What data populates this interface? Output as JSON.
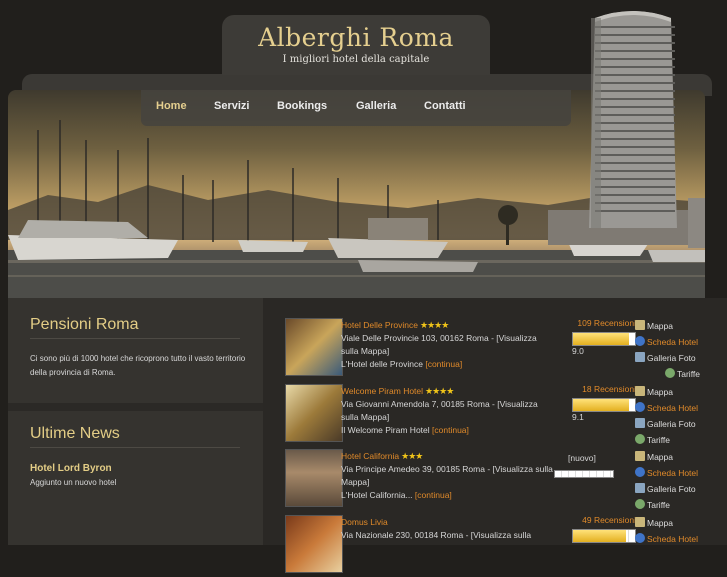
{
  "header": {
    "title": "Alberghi Roma",
    "subtitle": "I migliori hotel della capitale"
  },
  "nav": [
    {
      "label": "Home",
      "active": true
    },
    {
      "label": "Servizi"
    },
    {
      "label": "Bookings"
    },
    {
      "label": "Galleria"
    },
    {
      "label": "Contatti"
    }
  ],
  "sidebar": {
    "pensioni_title": "Pensioni Roma",
    "pensioni_text": "Ci sono più di 1000 hotel che ricoprono tutto il vasto territorio della provincia di Roma.",
    "news_title": "Ultime News",
    "news_item_title": "Hotel Lord Byron",
    "news_item_text": "Aggiunto un nuovo hotel"
  },
  "hotels": [
    {
      "name": "Hotel Delle Province",
      "stars": "★★★★",
      "address": "Viale Delle Provincie 103, 00162 Roma - [Visualizza sulla Mappa]",
      "desc": "L'Hotel delle Province",
      "more": "[continua]",
      "reviews": "109 Recensioni",
      "score": "9.0",
      "rating": 0.9,
      "links": [
        "Mappa",
        "Scheda Hotel",
        "Galleria Foto",
        "Tariffe"
      ]
    },
    {
      "name": "Welcome Piram Hotel",
      "stars": "★★★★",
      "address": "Via Giovanni Amendola 7, 00185 Roma - [Visualizza sulla Mappa]",
      "desc": "Il Welcome Piram Hotel",
      "more": "[continua]",
      "reviews": "18 Recensioni",
      "score": "9.1",
      "rating": 0.91,
      "links": [
        "Mappa",
        "Scheda Hotel",
        "Galleria Foto",
        "Tariffe"
      ]
    },
    {
      "name": "Hotel California",
      "stars": "★★★",
      "address": "Via Principe Amedeo 39, 00185 Roma - [Visualizza sulla Mappa]",
      "desc": "L'Hotel California...",
      "more": "[continua]",
      "nuovo": "[nuovo]",
      "rating": 0.0,
      "links": [
        "Mappa",
        "Scheda Hotel",
        "Galleria Foto",
        "Tariffe"
      ]
    },
    {
      "name": "Domus Livia",
      "stars": "",
      "address": "Via Nazionale 230, 00184 Roma - [Visualizza sulla",
      "desc": "",
      "more": "",
      "reviews": "49 Recensioni",
      "score": "",
      "rating": 0.85,
      "links": [
        "Mappa",
        "Scheda Hotel"
      ]
    }
  ],
  "colors": {
    "accent": "#e08a2a",
    "gold": "#e5cf8f",
    "background": "#211f1c"
  }
}
